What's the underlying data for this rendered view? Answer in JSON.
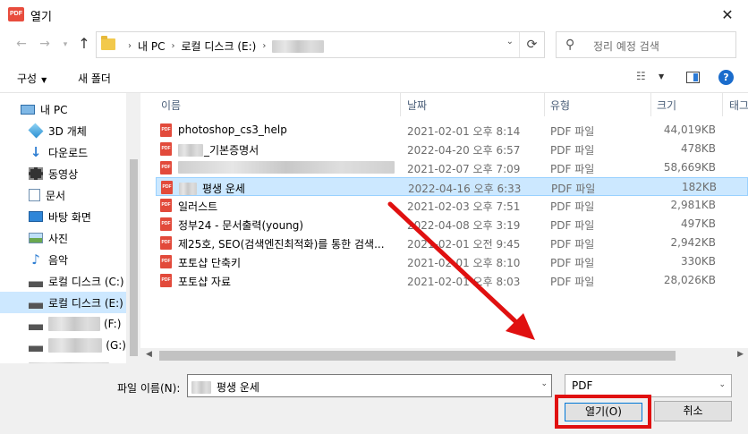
{
  "window": {
    "title": "열기",
    "close_glyph": "✕",
    "app_icon_text": "PDF"
  },
  "nav": {
    "back_glyph": "←",
    "forward_glyph": "→",
    "recent_glyph": "▾",
    "up_glyph": "↑",
    "breadcrumb": [
      "내 PC",
      "로컬 디스크 (E:)"
    ],
    "crumb_sep": "›",
    "refresh_glyph": "⟳",
    "dropdown_glyph": "⌄",
    "search_placeholder": "정리 예정 검색",
    "search_glyph": "⚲"
  },
  "toolbar": {
    "organize": "구성",
    "organize_caret": "▼",
    "new_folder": "새 폴더",
    "view_glyph": "☷",
    "view_caret": "▼",
    "help": "?"
  },
  "sidebar": {
    "items": [
      {
        "label": "내 PC",
        "icon": "pc-icon"
      },
      {
        "label": "3D 개체",
        "icon": "cube-icon"
      },
      {
        "label": "다운로드",
        "icon": "download-icon"
      },
      {
        "label": "동영상",
        "icon": "video-icon"
      },
      {
        "label": "문서",
        "icon": "document-icon"
      },
      {
        "label": "바탕 화면",
        "icon": "desktop-icon"
      },
      {
        "label": "사진",
        "icon": "picture-icon"
      },
      {
        "label": "음악",
        "icon": "music-icon"
      },
      {
        "label": "로컬 디스크 (C:)",
        "icon": "drive-icon"
      },
      {
        "label": "로컬 디스크 (E:)",
        "icon": "drive-icon",
        "selected": true
      },
      {
        "label": "(F:)",
        "icon": "drive-icon"
      },
      {
        "label": "(G:)",
        "icon": "drive-icon"
      }
    ]
  },
  "columns": {
    "name": "이름",
    "date": "날짜",
    "type": "유형",
    "size": "크기",
    "tags": "태그"
  },
  "files": [
    {
      "name": "photoshop_cs3_help",
      "date": "2021-02-01 오후 8:14",
      "type": "PDF 파일",
      "size": "44,019KB"
    },
    {
      "name": "_기본증명서",
      "date": "2022-04-20 오후 6:57",
      "type": "PDF 파일",
      "size": "478KB"
    },
    {
      "name": "",
      "date": "2021-02-07 오후 7:09",
      "type": "PDF 파일",
      "size": "58,669KB"
    },
    {
      "name": "평생 운세",
      "date": "2022-04-16 오후 6:33",
      "type": "PDF 파일",
      "size": "182KB",
      "selected": true
    },
    {
      "name": "일러스트",
      "date": "2021-02-03 오후 7:51",
      "type": "PDF 파일",
      "size": "2,981KB"
    },
    {
      "name": "정부24 - 문서출력(young)",
      "date": "2022-04-08 오후 3:19",
      "type": "PDF 파일",
      "size": "497KB"
    },
    {
      "name": "제25호, SEO(검색엔진최적화)를 통한 검색...",
      "date": "2021-02-01 오전 9:45",
      "type": "PDF 파일",
      "size": "2,942KB"
    },
    {
      "name": "포토샵 단축키",
      "date": "2021-02-01 오후 8:10",
      "type": "PDF 파일",
      "size": "330KB"
    },
    {
      "name": "포토샵 자료",
      "date": "2021-02-01 오후 8:03",
      "type": "PDF 파일",
      "size": "28,026KB"
    }
  ],
  "bottom": {
    "filename_label": "파일 이름(N):",
    "filename_value": "평생 운세",
    "filetype_value": "PDF",
    "open_button": "열기(O)",
    "cancel_button": "취소"
  },
  "colors": {
    "accent": "#0078d7",
    "selection": "#cce8ff",
    "highlight": "#e01010",
    "pdf_red": "#e24a3b"
  }
}
